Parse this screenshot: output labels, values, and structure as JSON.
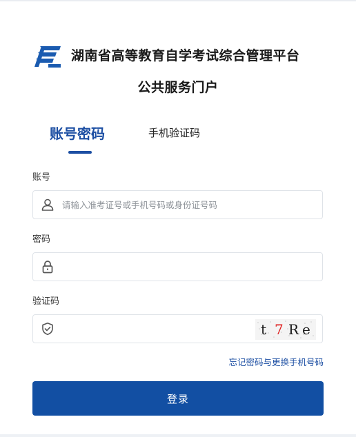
{
  "header": {
    "logo_icon": "exam-authority-logo",
    "title": "湖南省高等教育自学考试综合管理平台",
    "subtitle": "公共服务门户"
  },
  "tabs": [
    {
      "label": "账号密码",
      "active": true
    },
    {
      "label": "手机验证码",
      "active": false
    }
  ],
  "form": {
    "account": {
      "label": "账号",
      "placeholder": "请输入准考证号或手机号码或身份证号码",
      "value": "",
      "icon": "user-icon"
    },
    "password": {
      "label": "密码",
      "placeholder": "",
      "value": "",
      "icon": "lock-icon"
    },
    "captcha": {
      "label": "验证码",
      "placeholder": "",
      "value": "",
      "icon": "shield-check-icon",
      "image_text": "t7Re"
    }
  },
  "forgot_link": "忘记密码与更换手机号码",
  "login_button": "登录",
  "colors": {
    "primary": "#124fa3",
    "captcha_highlight": "#e02020"
  }
}
